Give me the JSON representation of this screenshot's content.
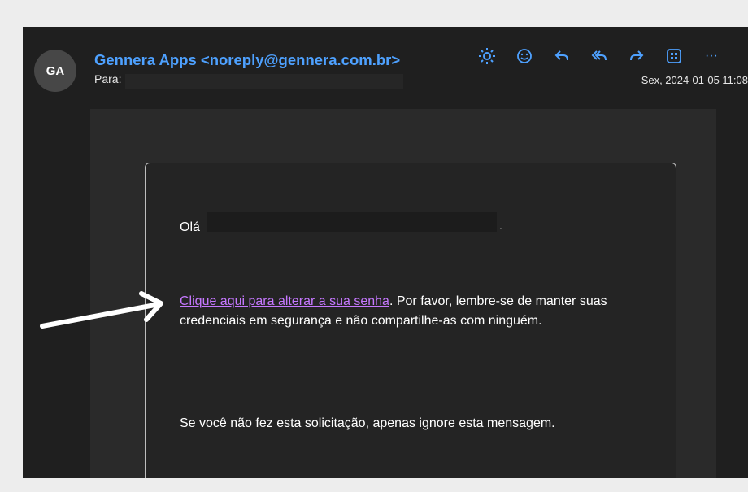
{
  "email": {
    "avatar_initials": "GA",
    "sender": "Gennera Apps <noreply@gennera.com.br>",
    "to_label": "Para:",
    "date": "Sex, 2024-01-05 11:08"
  },
  "toolbar": {
    "icons": [
      "sun-icon",
      "emoji-icon",
      "reply-icon",
      "reply-all-icon",
      "forward-icon",
      "apps-icon",
      "more-icon"
    ],
    "more_label": "···"
  },
  "message": {
    "greeting": "Olá",
    "greeting_end": ".",
    "link_text": "Clique aqui para alterar a sua senha",
    "para1_rest": ". Por favor, lembre-se de manter suas credenciais em segurança e não compartilhe-as com ninguém.",
    "para2": "Se você não fez esta solicitação, apenas ignore esta mensagem."
  },
  "colors": {
    "accent": "#4ea1ff",
    "link": "#c678ff",
    "background": "#1f1f1f"
  }
}
